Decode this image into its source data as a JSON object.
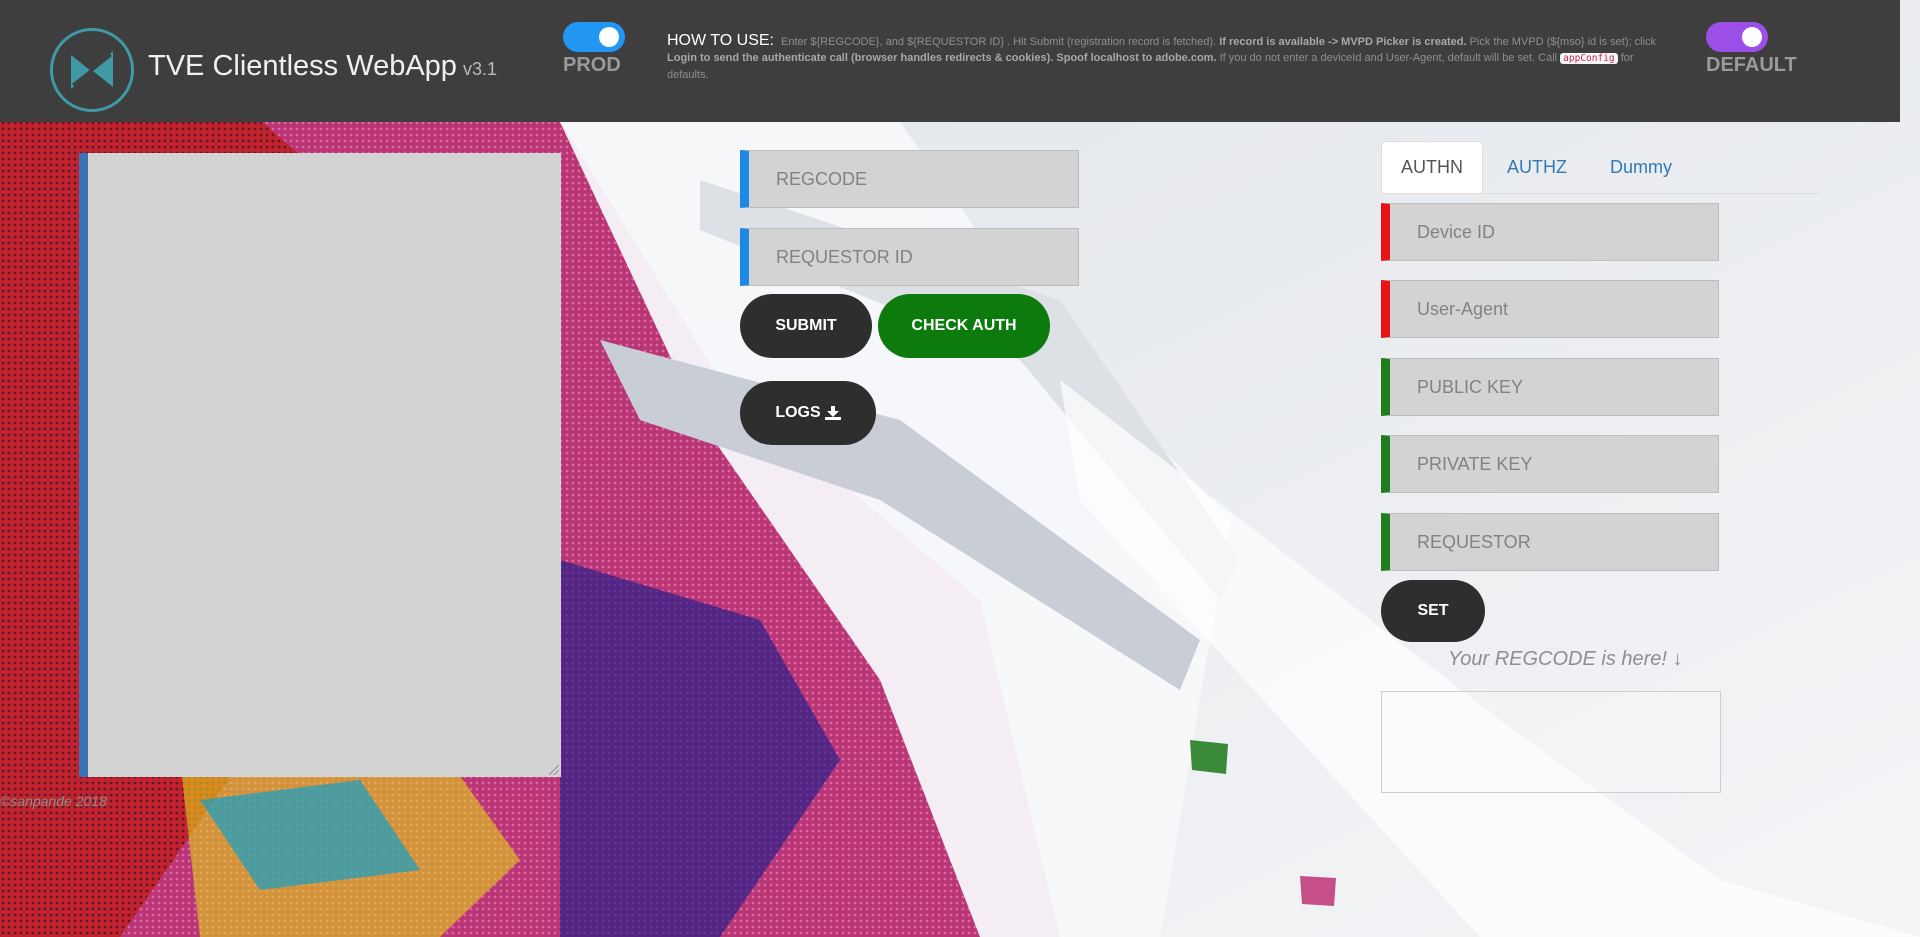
{
  "header": {
    "title": "TVE Clientless WebApp",
    "version": "v3.1",
    "env_toggle_label": "PROD",
    "env_toggle_on": true,
    "mode_toggle_label": "DEFAULT",
    "mode_toggle_on": true,
    "howto": {
      "title": "HOW TO USE:",
      "text_1": "Enter ${REGCODE}, and ${REQUESTOR ID} . Hit Submit (registration record is fetched).",
      "text_2": "If record is available -> MVPD Picker is created.",
      "text_3": "Pick the MVPD (${mso} id is set); click",
      "text_login": "Login",
      "text_4": "to send the authenticate call (browser handles redirects & cookies).",
      "text_5": "Spoof localhost to adobe.com.",
      "text_6": "If you do not enter a deviceId and User-Agent, default will be set. Call",
      "code": "appConfig",
      "text_7": "for defaults."
    }
  },
  "left": {
    "textarea_value": "",
    "copyright": "©sanpande 2018"
  },
  "center": {
    "regcode_placeholder": "REGCODE",
    "requestor_id_placeholder": "REQUESTOR ID",
    "submit_label": "SUBMIT",
    "check_auth_label": "CHECK AUTH",
    "logs_label": "LOGS"
  },
  "right": {
    "tabs": [
      {
        "label": "AUTHN",
        "active": true
      },
      {
        "label": "AUTHZ",
        "active": false
      },
      {
        "label": "Dummy",
        "active": false
      }
    ],
    "fields": {
      "device_id": "Device ID",
      "user_agent": "User-Agent",
      "public_key": "PUBLIC KEY",
      "private_key": "PRIVATE KEY",
      "requestor": "REQUESTOR"
    },
    "set_label": "SET",
    "regcode_hint": "Your REGCODE is here! ↓",
    "regcode_value": ""
  },
  "colors": {
    "header_bg": "#3e3e3e",
    "prod_toggle": "#2196f3",
    "default_toggle": "#9c4fe6",
    "check_auth": "#0c7a0c",
    "dark_button": "#2e2e2e",
    "accent_blue": "#1e88e5",
    "accent_red": "#e81313",
    "accent_green": "#1e7e1e"
  },
  "icons": {
    "logo": "tve-logo-icon",
    "logs": "download-icon"
  }
}
